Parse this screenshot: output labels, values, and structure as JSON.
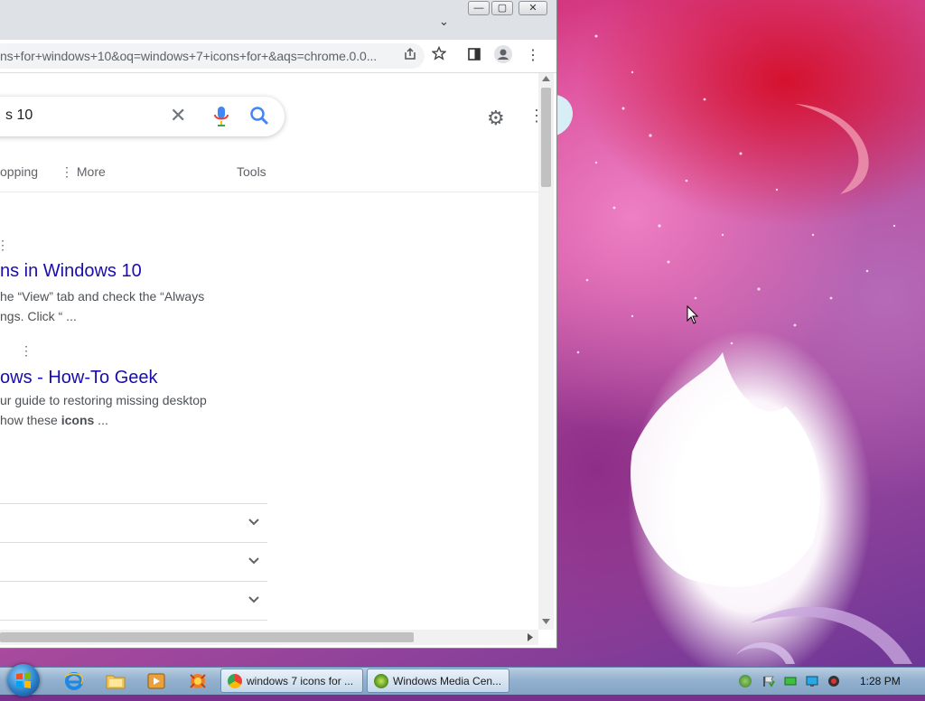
{
  "browser": {
    "url": "ns+for+windows+10&oq=windows+7+icons+for+&aqs=chrome.0.0...",
    "window_buttons": {
      "minimize": "—",
      "maximize": "▢",
      "close": "✕"
    },
    "tab_dropdown": "⌄"
  },
  "search": {
    "query": "s 10",
    "clear_icon": "✕",
    "settings_icon": "⚙",
    "apps_icon": "⋮"
  },
  "nav": {
    "shopping": "opping",
    "more": "More",
    "more_icon": "⋮",
    "tools": "Tools"
  },
  "results": [
    {
      "title": "ns in Windows 10",
      "snippet_line1": "he “View” tab and check the “Always",
      "snippet_line2": "ngs. Click “ ..."
    },
    {
      "title": "ows - How-To Geek",
      "snippet_line1": "ur guide to restoring missing desktop",
      "snippet_line2_pre": "how these ",
      "snippet_line2_bold": "icons",
      "snippet_line2_post": " ..."
    }
  ],
  "kebab_icon": "⋮",
  "taskbar": {
    "tasks": [
      {
        "label": "windows 7 icons for ...",
        "icon": "chrome-icon"
      },
      {
        "label": "Windows Media Cen...",
        "icon": "media-center-icon"
      }
    ],
    "clock": "1:28 PM"
  },
  "colors": {
    "link": "#1a0dab",
    "snippet": "#4d5156",
    "google_blue": "#4285f4"
  }
}
